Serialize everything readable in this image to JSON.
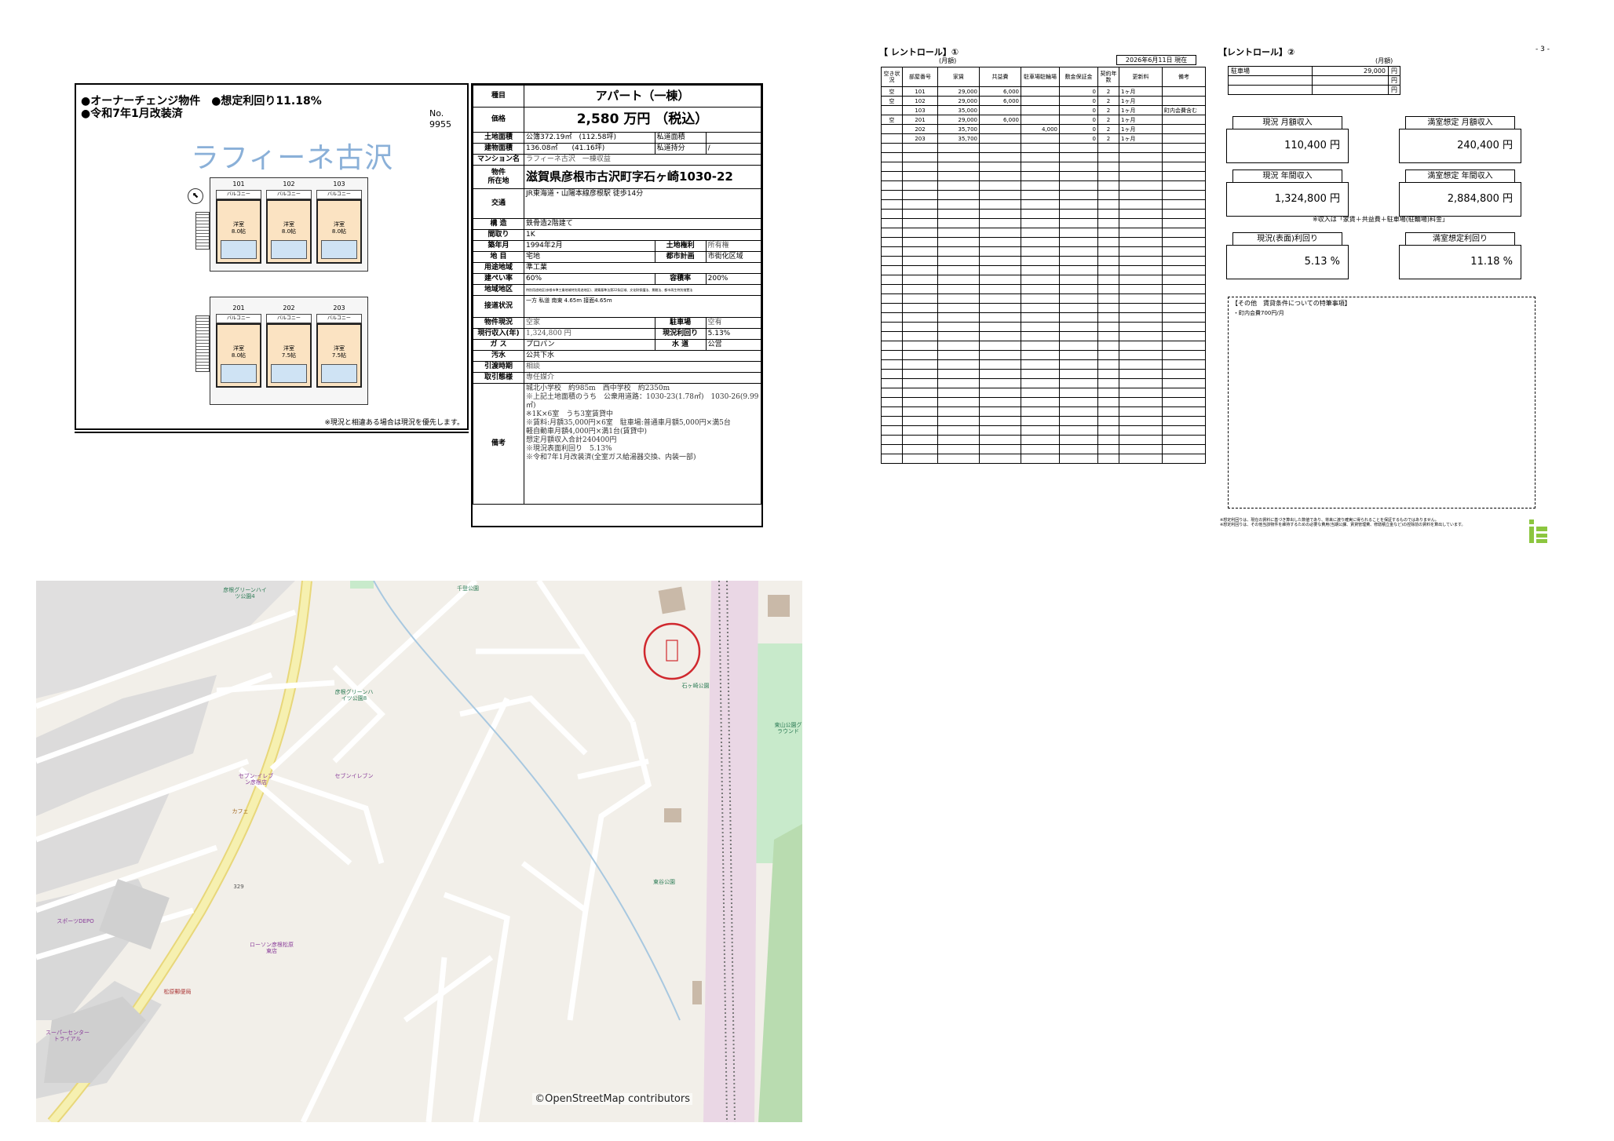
{
  "flyer": {
    "headline1": "●オーナーチェンジ物件　●想定利回り11.18%",
    "headline2": "●令和7年1月改装済",
    "no_label": "No.",
    "no_value": "9955",
    "building_name": "ラフィーネ古沢",
    "units_upper": [
      {
        "no": "101",
        "room": "洋室",
        "size": "8.0帖",
        "balcony": "バルコニー"
      },
      {
        "no": "102",
        "room": "洋室",
        "size": "8.0帖",
        "balcony": "バルコニー"
      },
      {
        "no": "103",
        "room": "洋室",
        "size": "8.0帖",
        "balcony": "バルコニー"
      }
    ],
    "units_lower": [
      {
        "no": "201",
        "room": "洋室",
        "size": "8.0帖",
        "balcony": "バルコニー"
      },
      {
        "no": "202",
        "room": "洋室",
        "size": "7.5帖",
        "balcony": "バルコニー"
      },
      {
        "no": "203",
        "room": "洋室",
        "size": "7.5帖",
        "balcony": "バルコニー"
      }
    ],
    "notice": "※現況と相違ある場合は現況を優先します。"
  },
  "spec": {
    "type_label": "種目",
    "type_value": "アパート（一棟）",
    "price_label": "価格",
    "price_value": "2,580 万円 （税込）",
    "land_label": "土地面積",
    "land_value": "公簿372.19㎡　(112.58坪)",
    "private_road_label": "私道面積",
    "bldg_label": "建物面積",
    "bldg_value": "136.08㎡　　(41.16坪)",
    "private_share_label": "私道持分",
    "private_share_value": "/",
    "name_label": "マンション名",
    "name_value": "ラフィーネ古沢　一棟収益",
    "addr_label": "物件\n所在地",
    "addr_value": "滋賀県彦根市古沢町字石ヶ崎1030-22",
    "traffic_label": "交通",
    "traffic_value": "JR東海道・山陽本線彦根駅 徒歩14分",
    "structure_label": "構 造",
    "structure_value": "鉄骨造2階建て",
    "layout_label": "間取り",
    "layout_value": "1K",
    "built_label": "築年月",
    "built_value": "1994年2月",
    "landright_label": "土地権利",
    "landright_value": "所有権",
    "category_label": "地 目",
    "category_value": "宅地",
    "cityplan_label": "都市計画",
    "cityplan_value": "市街化区域",
    "zone_label": "用途地域",
    "zone_value": "準工業",
    "bcr_label": "建ぺい率",
    "bcr_value": "60%",
    "far_label": "容積率",
    "far_value": "200%",
    "district_label": "地域地区",
    "district_value": "特別用途地区(彦根市準工業地域特別用途地区)、建築基準法第22条区域、文化財保護法、景観法、都市再生特別措置法",
    "road_label": "接道状況",
    "road_value": "一方 私道 南東 4.65m 接面4.65m",
    "status_label": "物件現況",
    "status_value": "空家",
    "parking_label": "駐車場",
    "parking_value": "空有",
    "income_label": "現行収入(年)",
    "income_value": "1,324,800 円",
    "yield_label": "現況利回り",
    "yield_value": "5.13%",
    "gas_label": "ガ ス",
    "gas_value": "プロパン",
    "water_label": "水 道",
    "water_value": "公営",
    "sewer_label": "汚水",
    "sewer_value": "公共下水",
    "handover_label": "引渡時期",
    "handover_value": "相談",
    "deal_label": "取引態様",
    "deal_value": "専任媒介",
    "remarks_label": "備考",
    "remarks": [
      "城北小学校　約985m　西中学校　約2350m",
      "※上記土地面積のうち　公衆用道路：1030-23(1.78㎡)　1030-26(9.99㎡)",
      "※1K×6室　うち3室賃貸中",
      "※賃料:月額35,000円×6室　駐車場:普通車月額5,000円×満5台",
      "軽自動車月額4,000円×満1台(賃貸中)",
      "想定月額収入合計240400円",
      "※現況表面利回り　5.13%",
      "※令和7年1月改装済(全室ガス給湯器交換、内装一部)"
    ]
  },
  "map": {
    "credit": "©OpenStreetMap contributors",
    "labels": [
      "千登公園",
      "彦根グリーンハイツ公園4",
      "石ヶ崎公園",
      "東山公園グラウンド",
      "東谷公園",
      "彦根グリーンハイツ公園8",
      "セブン-イレブン彦根店",
      "カフェ",
      "スポーツDEPO",
      "ローソン彦根松原東店",
      "セブンイレブン",
      "スーパーセンタートライアル",
      "松原郵便局",
      "329"
    ]
  },
  "rentroll1": {
    "title": "【 レントロール】①",
    "unit": "(月額)",
    "date": "2026年6月11日 現在",
    "headers": [
      "空き状況",
      "部屋番号",
      "家賃",
      "共益費",
      "駐車場駐輪場",
      "敷金保証金",
      "契約年数",
      "更新料",
      "備考"
    ],
    "rows": [
      [
        "空",
        "101",
        "29,000",
        "6,000",
        "",
        "0",
        "2",
        "1ヶ月",
        ""
      ],
      [
        "空",
        "102",
        "29,000",
        "6,000",
        "",
        "0",
        "2",
        "1ヶ月",
        ""
      ],
      [
        "",
        "103",
        "35,000",
        "",
        "",
        "0",
        "2",
        "1ヶ月",
        "町内会費含む"
      ],
      [
        "空",
        "201",
        "29,000",
        "6,000",
        "",
        "0",
        "2",
        "1ヶ月",
        ""
      ],
      [
        "",
        "202",
        "35,700",
        "",
        "4,000",
        "0",
        "2",
        "1ヶ月",
        ""
      ],
      [
        "",
        "203",
        "35,700",
        "",
        "",
        "0",
        "2",
        "1ヶ月",
        ""
      ]
    ],
    "empty_rows": 34
  },
  "rentroll2": {
    "title": "【レントロール】②",
    "page": "- 3 -",
    "unit": "(月額)",
    "parking": [
      [
        "駐車場",
        "29,000",
        "円"
      ],
      [
        "",
        "",
        "円"
      ],
      [
        "",
        "",
        "円"
      ]
    ],
    "current_monthly_label": "現況 月額収入",
    "current_monthly_value": "110,400 円",
    "full_monthly_label": "満室想定 月額収入",
    "full_monthly_value": "240,400 円",
    "current_annual_label": "現況 年間収入",
    "current_annual_value": "1,324,800 円",
    "full_annual_label": "満室想定 年間収入",
    "full_annual_value": "2,884,800 円",
    "income_note": "※収入は「家賃＋共益費＋駐車場(駐輪場)料金」",
    "current_yield_label": "現況(表面)利回り",
    "current_yield_value": "5.13 %",
    "full_yield_label": "満室想定利回り",
    "full_yield_value": "11.18 %",
    "special_title": "【その他　賃貸条件についての特筆事項】",
    "special_body": "・町内会費700円/月",
    "footnote1": "※想定利回りは、現在の賃料に基づき算出した数値であり、将来に渡り確実に得られることを保証するものではありません。",
    "footnote2": "※想定利回りは、その他当該物件を維持するための必要な費用(当期公課、賃貸管理費、修繕積立金など)の控除前の賃料を算出しています。"
  },
  "colors": {
    "accent_green": "#8cc63f",
    "title_blue": "#8ab0d8",
    "map_bg": "#f2efe9",
    "map_marker": "#d0282e"
  }
}
